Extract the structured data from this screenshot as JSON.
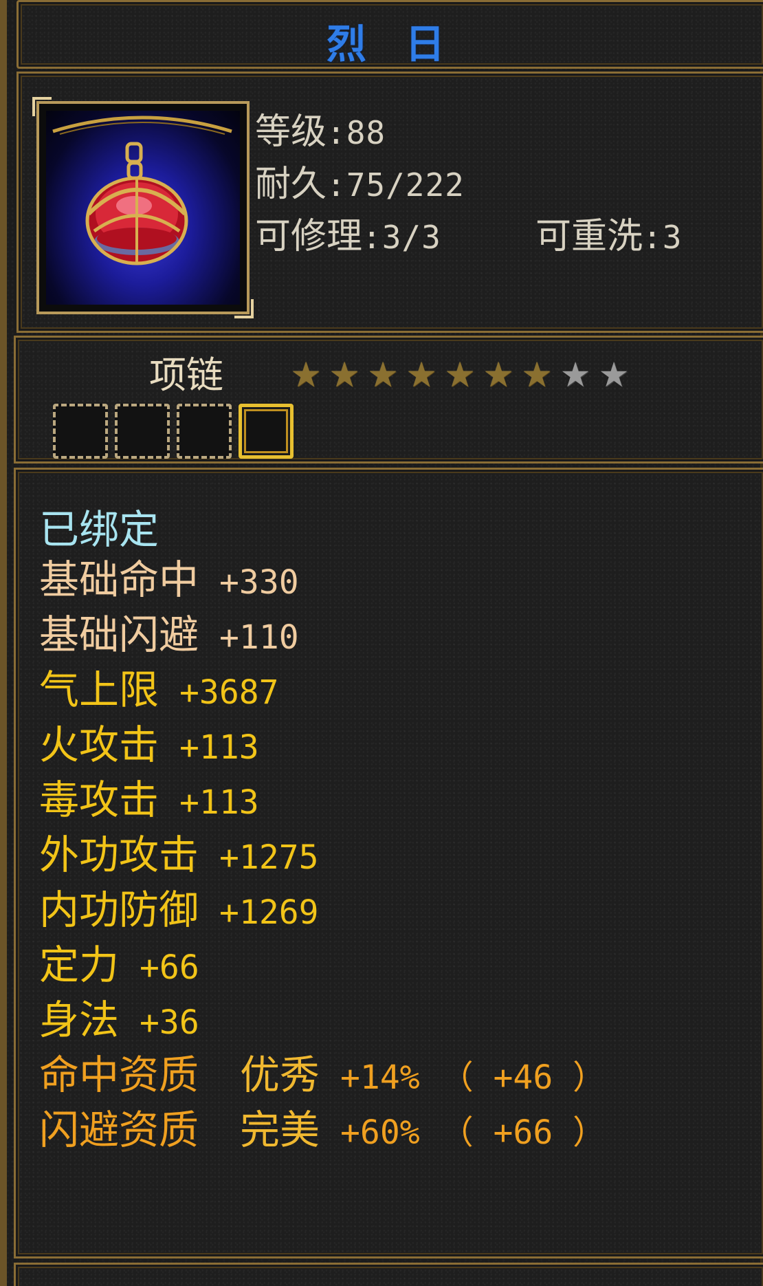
{
  "item": {
    "name": "烈 日",
    "icon": "ruby-necklace-icon",
    "level_label": "等级",
    "level_value": ":88",
    "durability_label": "耐久",
    "durability_value": ":75/222",
    "repair_label": "可修理",
    "repair_value": ":3/3",
    "rewash_label": "可重洗",
    "rewash_value": ":3",
    "type": "项链",
    "stars": {
      "filled": 7,
      "total": 9
    },
    "slots": [
      {
        "active": false
      },
      {
        "active": false
      },
      {
        "active": false
      },
      {
        "active": true
      }
    ]
  },
  "stats": {
    "bound": "已绑定",
    "lines": [
      {
        "name": "基础命中",
        "value": "+330",
        "color": "#f0cca0"
      },
      {
        "name": "基础闪避",
        "value": "+110",
        "color": "#f0cca0"
      },
      {
        "name": "气上限",
        "value": "+3687",
        "color": "#f2c418"
      },
      {
        "name": "火攻击",
        "value": "+113",
        "color": "#f2c418"
      },
      {
        "name": "毒攻击",
        "value": "+113",
        "color": "#f2c418"
      },
      {
        "name": "外功攻击",
        "value": "+1275",
        "color": "#f2c418"
      },
      {
        "name": "内功防御",
        "value": "+1269",
        "color": "#f2c418"
      },
      {
        "name": "定力",
        "value": "+66",
        "color": "#f2c418"
      },
      {
        "name": "身法",
        "value": "+36",
        "color": "#f2c418"
      }
    ],
    "aptitudes": [
      {
        "name": "命中资质",
        "grade": "优秀",
        "pct": "+14%",
        "bonus": "（ +46 ）",
        "color": "#f0a020"
      },
      {
        "name": "闪避资质",
        "grade": "完美",
        "pct": "+60%",
        "bonus": "（ +66 ）",
        "color": "#f0a020"
      }
    ]
  },
  "footer": {
    "text": ""
  }
}
